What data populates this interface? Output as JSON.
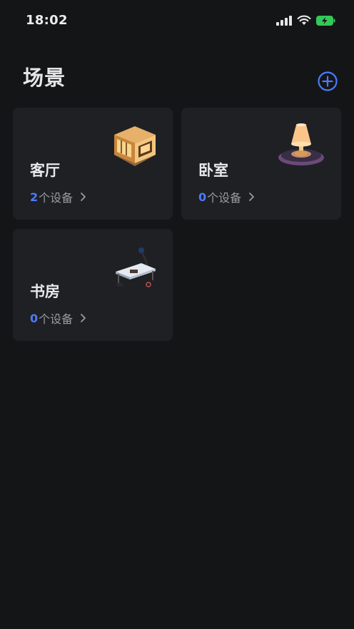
{
  "status_bar": {
    "time": "18:02"
  },
  "header": {
    "title": "场景"
  },
  "colors": {
    "accent": "#4a7bff",
    "background": "#141517",
    "card": "#1f2024"
  },
  "scenes": [
    {
      "name": "客厅",
      "device_count": "2",
      "device_suffix": "个设备",
      "icon": "house-icon"
    },
    {
      "name": "卧室",
      "device_count": "0",
      "device_suffix": "个设备",
      "icon": "lamp-icon"
    },
    {
      "name": "书房",
      "device_count": "0",
      "device_suffix": "个设备",
      "icon": "desk-icon"
    }
  ]
}
